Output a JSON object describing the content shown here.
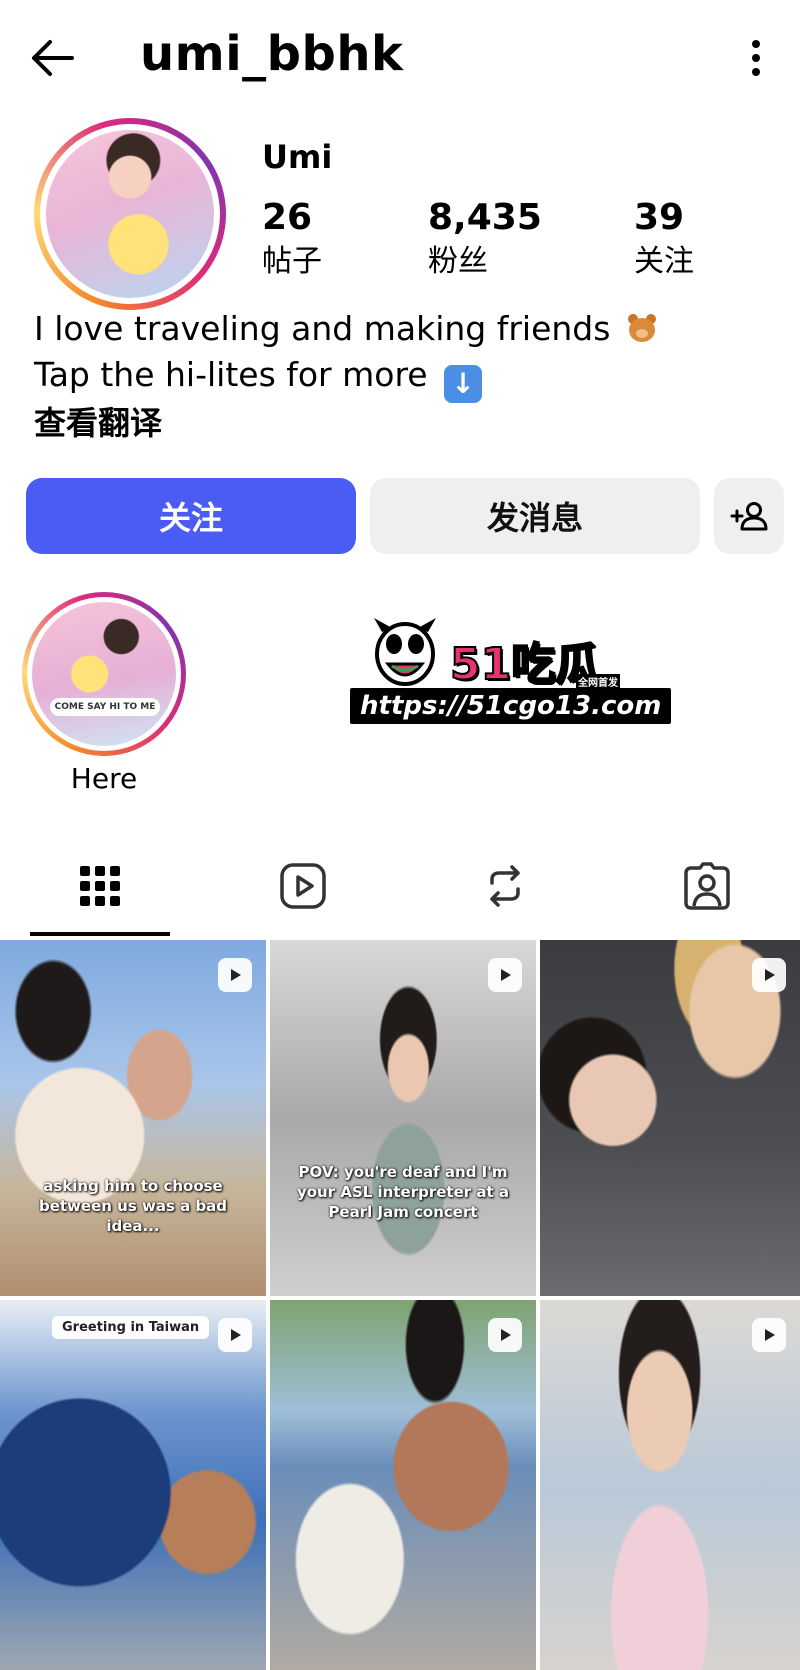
{
  "header": {
    "username": "umi_bbhk"
  },
  "profile": {
    "display_name": "Umi",
    "stats": [
      {
        "value": "26",
        "label": "帖子"
      },
      {
        "value": "8,435",
        "label": "粉丝"
      },
      {
        "value": "39",
        "label": "关注"
      }
    ],
    "bio_line1": "I love traveling and making friends",
    "bio_line2": "Tap the hi-lites for more",
    "translate_label": "查看翻译"
  },
  "actions": {
    "follow_label": "关注",
    "message_label": "发消息"
  },
  "highlights": [
    {
      "label": "Here",
      "chip_text": "COME SAY HI TO ME"
    }
  ],
  "watermark": {
    "title": "51吃瓜",
    "subtitle": "全网首发",
    "url": "https://51cgo13.com"
  },
  "tabs": [
    {
      "icon": "grid-icon",
      "active": true
    },
    {
      "icon": "reels-icon",
      "active": false
    },
    {
      "icon": "repost-icon",
      "active": false
    },
    {
      "icon": "tagged-icon",
      "active": false
    }
  ],
  "posts": [
    {
      "caption": "asking him to choose between us was a bad idea..."
    },
    {
      "caption": "POV: you're deaf and I'm your ASL interpreter at a Pearl Jam concert"
    },
    {
      "caption": ""
    },
    {
      "caption": "",
      "chip": "Greeting in Taiwan"
    },
    {
      "caption": ""
    },
    {
      "caption": ""
    }
  ]
}
